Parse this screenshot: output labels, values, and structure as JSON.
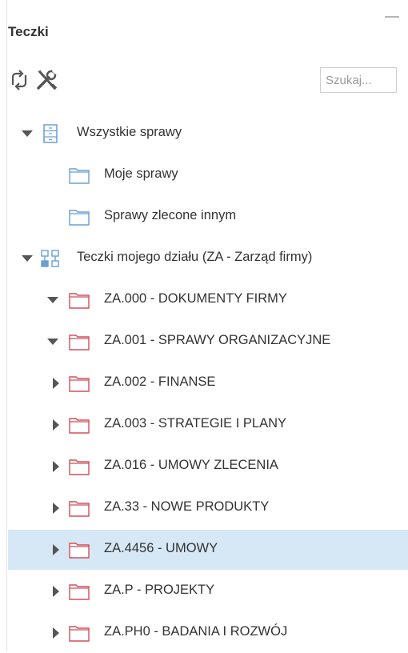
{
  "panel": {
    "title": "Teczki"
  },
  "toolbar": {
    "search_placeholder": "Szukaj..."
  },
  "tree": {
    "all_cases": "Wszystkie sprawy",
    "my_cases": "Moje sprawy",
    "delegated_cases": "Sprawy zlecone innym",
    "dept_folders": "Teczki mojego działu (ZA - Zarząd firmy)",
    "folders": [
      "ZA.000 - DOKUMENTY FIRMY",
      "ZA.001 - SPRAWY ORGANIZACYJNE",
      "ZA.002 - FINANSE",
      "ZA.003 - STRATEGIE I PLANY",
      "ZA.016 - UMOWY ZLECENIA",
      "ZA.33 - NOWE PRODUKTY",
      "ZA.4456 - UMOWY",
      "ZA.P - PROJEKTY",
      "ZA.PH0 - BADANIA I ROZWÓJ"
    ]
  },
  "colors": {
    "selected_row": "#d6e8f5",
    "blue_folder": "#6a9fd4",
    "red_folder": "#d0505a",
    "toggle": "#555555"
  }
}
